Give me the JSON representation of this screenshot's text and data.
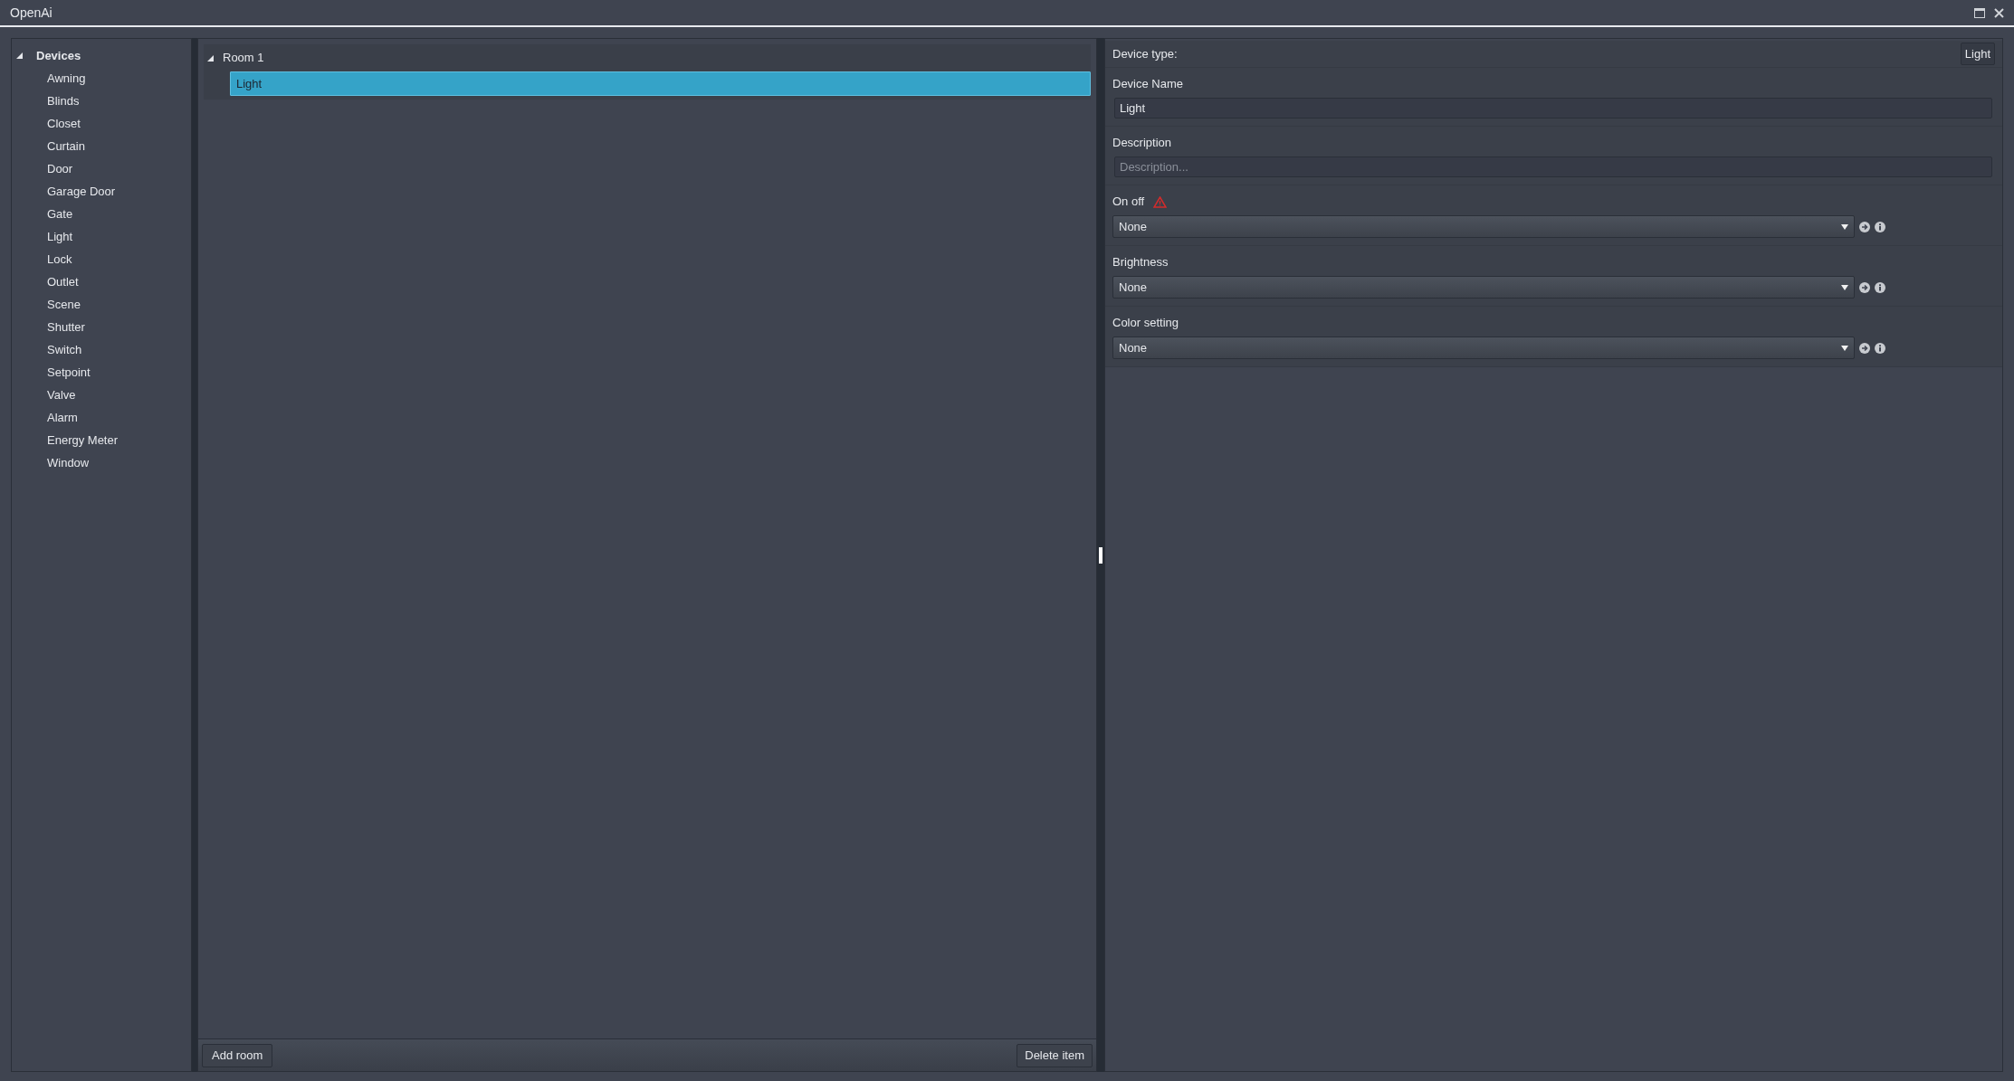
{
  "window": {
    "title": "OpenAi"
  },
  "devices": {
    "label": "Devices",
    "expanded": true,
    "children": [
      {
        "label": "Awning"
      },
      {
        "label": "Blinds"
      },
      {
        "label": "Closet"
      },
      {
        "label": "Curtain"
      },
      {
        "label": "Door"
      },
      {
        "label": "Garage Door"
      },
      {
        "label": "Gate"
      },
      {
        "label": "Light"
      },
      {
        "label": "Lock"
      },
      {
        "label": "Outlet"
      },
      {
        "label": "Scene"
      },
      {
        "label": "Shutter"
      },
      {
        "label": "Switch"
      },
      {
        "label": "Setpoint"
      },
      {
        "label": "Valve"
      },
      {
        "label": "Alarm"
      },
      {
        "label": "Energy Meter"
      },
      {
        "label": "Window"
      }
    ]
  },
  "rooms": [
    {
      "label": "Room 1",
      "expanded": true,
      "children": [
        {
          "label": "Light",
          "selected": true
        }
      ]
    }
  ],
  "room_buttons": {
    "add": "Add room",
    "delete": "Delete item"
  },
  "properties": {
    "device_type_label": "Device type:",
    "device_type": "Light",
    "fields": [
      {
        "kind": "text",
        "label": "Device Name",
        "value": "Light"
      },
      {
        "kind": "text",
        "label": "Description",
        "placeholder": "Description..."
      },
      {
        "kind": "select",
        "label": "On off",
        "warning": true,
        "value": "None"
      },
      {
        "kind": "select",
        "label": "Brightness",
        "warning": false,
        "value": "None"
      },
      {
        "kind": "select",
        "label": "Color setting",
        "warning": false,
        "value": "None"
      }
    ]
  }
}
